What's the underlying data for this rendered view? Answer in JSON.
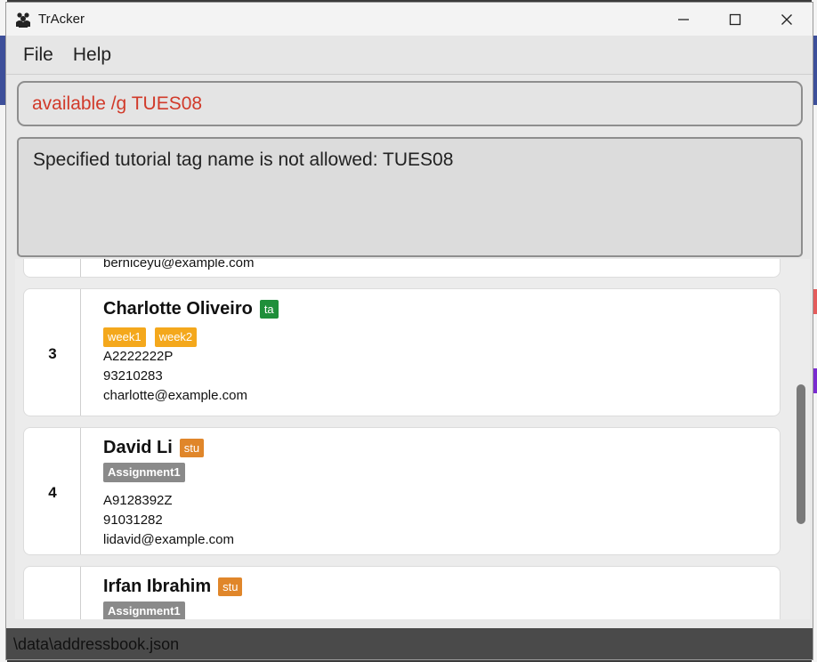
{
  "window": {
    "title": "TrAcker",
    "app_icon": "users-icon",
    "controls": [
      "minimize-icon",
      "maximize-icon",
      "close-icon"
    ]
  },
  "menu": {
    "items": [
      "File",
      "Help"
    ]
  },
  "command": {
    "value": "available /g TUES08"
  },
  "result": {
    "message": "Specified tutorial tag name is not allowed: TUES08"
  },
  "persons": [
    {
      "email": "berniceyu@example.com"
    },
    {
      "index": "3",
      "name": "Charlotte Oliveiro",
      "role": "ta",
      "tags": [
        "week1",
        "week2"
      ],
      "id": "A2222222P",
      "phone": "93210283",
      "email": "charlotte@example.com"
    },
    {
      "index": "4",
      "name": "David Li",
      "role": "stu",
      "tags": [
        "Assignment1"
      ],
      "id": "A9128392Z",
      "phone": "91031282",
      "email": "lidavid@example.com"
    },
    {
      "name": "Irfan Ibrahim",
      "role": "stu",
      "tags": [
        "Assignment1"
      ]
    }
  ],
  "status": {
    "path": "\\data\\addressbook.json"
  },
  "colors": {
    "command_error": "#d13a2a",
    "ta_badge": "#1f8f3a",
    "stu_badge": "#e0862a",
    "week_tag": "#f4a81c",
    "assignment_tag": "#8a8a8a"
  }
}
